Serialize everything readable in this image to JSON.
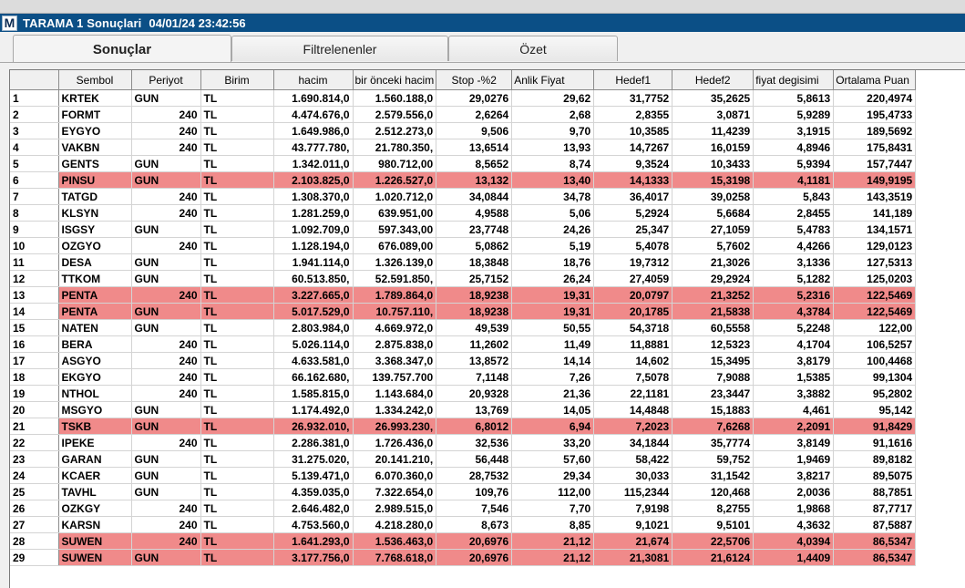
{
  "window": {
    "icon_letter": "M",
    "title": "TARAMA 1 Sonuçlari",
    "timestamp": "04/01/24 23:42:56",
    "titlebar_color": "#0b4f86"
  },
  "tabs": [
    {
      "label": "Sonuçlar",
      "active": true
    },
    {
      "label": "Filtrelenenler",
      "active": false
    },
    {
      "label": "Özet",
      "active": false
    }
  ],
  "highlight_color": "#f08a8a",
  "table": {
    "columns": [
      "Sembol",
      "Periyot",
      "Birim",
      "hacim",
      "bir önceki hacim",
      "Stop -%2",
      "Anlik Fiyat",
      "Hedef1",
      "Hedef2",
      "fiyat degisimi",
      "Ortalama Puan"
    ],
    "rows": [
      {
        "n": "1",
        "highlight": false,
        "cells": [
          "KRTEK",
          "GUN",
          "TL",
          "1.690.814,0",
          "1.560.188,0",
          "29,0276",
          "29,62",
          "31,7752",
          "35,2625",
          "5,8613",
          "220,4974"
        ]
      },
      {
        "n": "2",
        "highlight": false,
        "cells": [
          "FORMT",
          "240",
          "TL",
          "4.474.676,0",
          "2.579.556,0",
          "2,6264",
          "2,68",
          "2,8355",
          "3,0871",
          "5,9289",
          "195,4733"
        ]
      },
      {
        "n": "3",
        "highlight": false,
        "cells": [
          "EYGYO",
          "240",
          "TL",
          "1.649.986,0",
          "2.512.273,0",
          "9,506",
          "9,70",
          "10,3585",
          "11,4239",
          "3,1915",
          "189,5692"
        ]
      },
      {
        "n": "4",
        "highlight": false,
        "cells": [
          "VAKBN",
          "240",
          "TL",
          "43.777.780,",
          "21.780.350,",
          "13,6514",
          "13,93",
          "14,7267",
          "16,0159",
          "4,8946",
          "175,8431"
        ]
      },
      {
        "n": "5",
        "highlight": false,
        "cells": [
          "GENTS",
          "GUN",
          "TL",
          "1.342.011,0",
          "980.712,00",
          "8,5652",
          "8,74",
          "9,3524",
          "10,3433",
          "5,9394",
          "157,7447"
        ]
      },
      {
        "n": "6",
        "highlight": true,
        "cells": [
          "PINSU",
          "GUN",
          "TL",
          "2.103.825,0",
          "1.226.527,0",
          "13,132",
          "13,40",
          "14,1333",
          "15,3198",
          "4,1181",
          "149,9195"
        ]
      },
      {
        "n": "7",
        "highlight": false,
        "cells": [
          "TATGD",
          "240",
          "TL",
          "1.308.370,0",
          "1.020.712,0",
          "34,0844",
          "34,78",
          "36,4017",
          "39,0258",
          "5,843",
          "143,3519"
        ]
      },
      {
        "n": "8",
        "highlight": false,
        "cells": [
          "KLSYN",
          "240",
          "TL",
          "1.281.259,0",
          "639.951,00",
          "4,9588",
          "5,06",
          "5,2924",
          "5,6684",
          "2,8455",
          "141,189"
        ]
      },
      {
        "n": "9",
        "highlight": false,
        "cells": [
          "ISGSY",
          "GUN",
          "TL",
          "1.092.709,0",
          "597.343,00",
          "23,7748",
          "24,26",
          "25,347",
          "27,1059",
          "5,4783",
          "134,1571"
        ]
      },
      {
        "n": "10",
        "highlight": false,
        "cells": [
          "OZGYO",
          "240",
          "TL",
          "1.128.194,0",
          "676.089,00",
          "5,0862",
          "5,19",
          "5,4078",
          "5,7602",
          "4,4266",
          "129,0123"
        ]
      },
      {
        "n": "11",
        "highlight": false,
        "cells": [
          "DESA",
          "GUN",
          "TL",
          "1.941.114,0",
          "1.326.139,0",
          "18,3848",
          "18,76",
          "19,7312",
          "21,3026",
          "3,1336",
          "127,5313"
        ]
      },
      {
        "n": "12",
        "highlight": false,
        "cells": [
          "TTKOM",
          "GUN",
          "TL",
          "60.513.850,",
          "52.591.850,",
          "25,7152",
          "26,24",
          "27,4059",
          "29,2924",
          "5,1282",
          "125,0203"
        ]
      },
      {
        "n": "13",
        "highlight": true,
        "cells": [
          "PENTA",
          "240",
          "TL",
          "3.227.665,0",
          "1.789.864,0",
          "18,9238",
          "19,31",
          "20,0797",
          "21,3252",
          "5,2316",
          "122,5469"
        ]
      },
      {
        "n": "14",
        "highlight": true,
        "cells": [
          "PENTA",
          "GUN",
          "TL",
          "5.017.529,0",
          "10.757.110,",
          "18,9238",
          "19,31",
          "20,1785",
          "21,5838",
          "4,3784",
          "122,5469"
        ]
      },
      {
        "n": "15",
        "highlight": false,
        "cells": [
          "NATEN",
          "GUN",
          "TL",
          "2.803.984,0",
          "4.669.972,0",
          "49,539",
          "50,55",
          "54,3718",
          "60,5558",
          "5,2248",
          "122,00"
        ]
      },
      {
        "n": "16",
        "highlight": false,
        "cells": [
          "BERA",
          "240",
          "TL",
          "5.026.114,0",
          "2.875.838,0",
          "11,2602",
          "11,49",
          "11,8881",
          "12,5323",
          "4,1704",
          "106,5257"
        ]
      },
      {
        "n": "17",
        "highlight": false,
        "cells": [
          "ASGYO",
          "240",
          "TL",
          "4.633.581,0",
          "3.368.347,0",
          "13,8572",
          "14,14",
          "14,602",
          "15,3495",
          "3,8179",
          "100,4468"
        ]
      },
      {
        "n": "18",
        "highlight": false,
        "cells": [
          "EKGYO",
          "240",
          "TL",
          "66.162.680,",
          "139.757.700",
          "7,1148",
          "7,26",
          "7,5078",
          "7,9088",
          "1,5385",
          "99,1304"
        ]
      },
      {
        "n": "19",
        "highlight": false,
        "cells": [
          "NTHOL",
          "240",
          "TL",
          "1.585.815,0",
          "1.143.684,0",
          "20,9328",
          "21,36",
          "22,1181",
          "23,3447",
          "3,3882",
          "95,2802"
        ]
      },
      {
        "n": "20",
        "highlight": false,
        "cells": [
          "MSGYO",
          "GUN",
          "TL",
          "1.174.492,0",
          "1.334.242,0",
          "13,769",
          "14,05",
          "14,4848",
          "15,1883",
          "4,461",
          "95,142"
        ]
      },
      {
        "n": "21",
        "highlight": true,
        "cells": [
          "TSKB",
          "GUN",
          "TL",
          "26.932.010,",
          "26.993.230,",
          "6,8012",
          "6,94",
          "7,2023",
          "7,6268",
          "2,2091",
          "91,8429"
        ]
      },
      {
        "n": "22",
        "highlight": false,
        "cells": [
          "IPEKE",
          "240",
          "TL",
          "2.286.381,0",
          "1.726.436,0",
          "32,536",
          "33,20",
          "34,1844",
          "35,7774",
          "3,8149",
          "91,1616"
        ]
      },
      {
        "n": "23",
        "highlight": false,
        "cells": [
          "GARAN",
          "GUN",
          "TL",
          "31.275.020,",
          "20.141.210,",
          "56,448",
          "57,60",
          "58,422",
          "59,752",
          "1,9469",
          "89,8182"
        ]
      },
      {
        "n": "24",
        "highlight": false,
        "cells": [
          "KCAER",
          "GUN",
          "TL",
          "5.139.471,0",
          "6.070.360,0",
          "28,7532",
          "29,34",
          "30,033",
          "31,1542",
          "3,8217",
          "89,5075"
        ]
      },
      {
        "n": "25",
        "highlight": false,
        "cells": [
          "TAVHL",
          "GUN",
          "TL",
          "4.359.035,0",
          "7.322.654,0",
          "109,76",
          "112,00",
          "115,2344",
          "120,468",
          "2,0036",
          "88,7851"
        ]
      },
      {
        "n": "26",
        "highlight": false,
        "cells": [
          "OZKGY",
          "240",
          "TL",
          "2.646.482,0",
          "2.989.515,0",
          "7,546",
          "7,70",
          "7,9198",
          "8,2755",
          "1,9868",
          "87,7717"
        ]
      },
      {
        "n": "27",
        "highlight": false,
        "cells": [
          "KARSN",
          "240",
          "TL",
          "4.753.560,0",
          "4.218.280,0",
          "8,673",
          "8,85",
          "9,1021",
          "9,5101",
          "4,3632",
          "87,5887"
        ]
      },
      {
        "n": "28",
        "highlight": true,
        "cells": [
          "SUWEN",
          "240",
          "TL",
          "1.641.293,0",
          "1.536.463,0",
          "20,6976",
          "21,12",
          "21,674",
          "22,5706",
          "4,0394",
          "86,5347"
        ]
      },
      {
        "n": "29",
        "highlight": true,
        "cells": [
          "SUWEN",
          "GUN",
          "TL",
          "3.177.756,0",
          "7.768.618,0",
          "20,6976",
          "21,12",
          "21,3081",
          "21,6124",
          "1,4409",
          "86,5347"
        ]
      }
    ]
  }
}
